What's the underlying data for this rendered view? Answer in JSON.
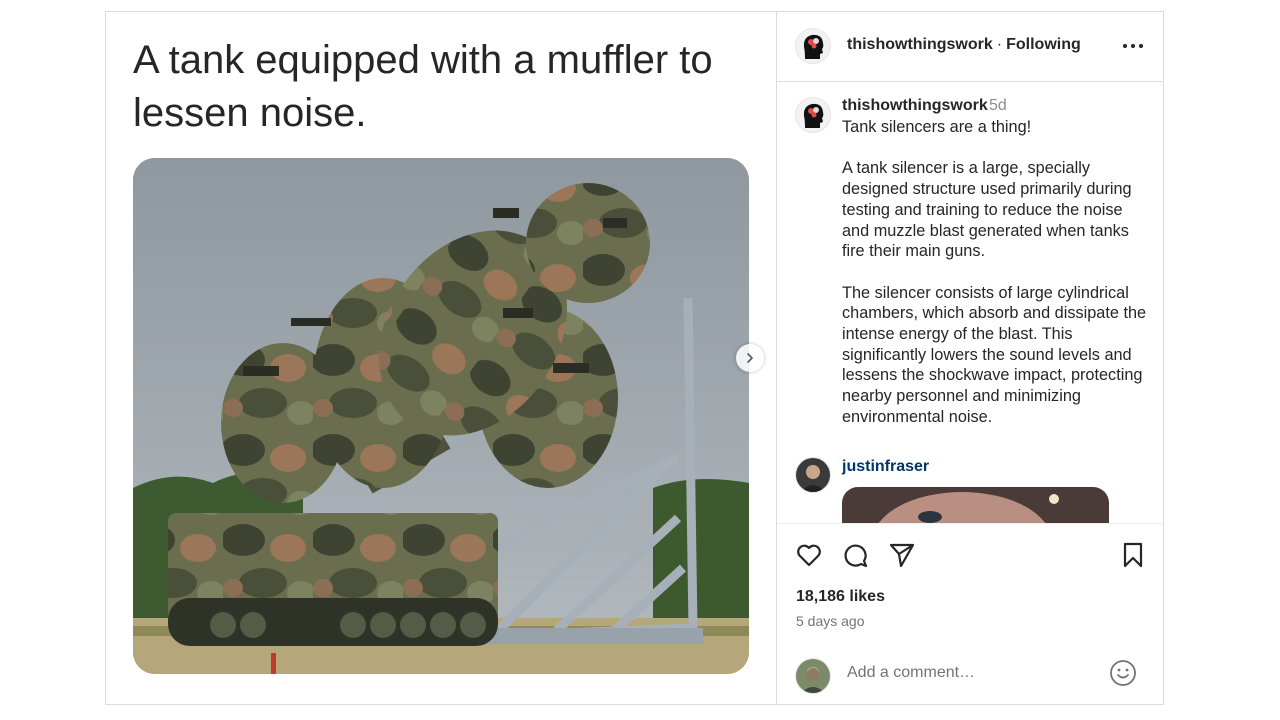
{
  "post": {
    "headline": "A tank equipped with a muffler to lessen noise."
  },
  "header": {
    "username": "thishowthingswork",
    "separator": "·",
    "follow_status": "Following",
    "more_icon": "more-horizontal-icon"
  },
  "caption": {
    "username": "thishowthingswork",
    "time": "5d",
    "text": "Tank silencers are a thing!\n\nA tank silencer is a large, specially designed structure used primarily during testing and training to reduce the noise and muzzle blast generated when tanks fire their main guns.\n\nThe silencer consists of large cylindrical chambers, which absorb and dissipate the intense energy of the blast. This significantly lowers the sound levels and lessens the shockwave impact, protecting nearby personnel and minimizing environmental noise."
  },
  "comment": {
    "username": "justinfraser"
  },
  "actions": {
    "like_icon": "heart-icon",
    "comment_icon": "comment-bubble-icon",
    "share_icon": "paper-plane-icon",
    "save_icon": "bookmark-icon"
  },
  "stats": {
    "likes": "18,186 likes",
    "time_ago": "5 days ago"
  },
  "comment_box": {
    "placeholder": "Add a comment…",
    "emoji_icon": "smiley-icon"
  },
  "colors": {
    "border": "#dbdbdb",
    "text": "#262626",
    "muted": "#737373",
    "link": "#00376b"
  }
}
